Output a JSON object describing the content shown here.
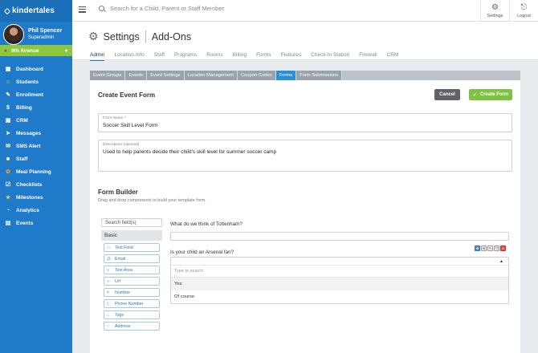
{
  "brand": {
    "name": "kindertales"
  },
  "user": {
    "name": "Phil Spencer",
    "role": "Superadmin"
  },
  "location": {
    "name": "9th Avenue"
  },
  "nav": [
    {
      "label": "Dashboard",
      "icon": "dashboard-icon"
    },
    {
      "label": "Students",
      "icon": "students-icon"
    },
    {
      "label": "Enrollment",
      "icon": "enrollment-icon"
    },
    {
      "label": "Billing",
      "icon": "billing-icon"
    },
    {
      "label": "CRM",
      "icon": "crm-icon"
    },
    {
      "label": "Messages",
      "icon": "messages-icon"
    },
    {
      "label": "SMS Alert",
      "icon": "sms-icon"
    },
    {
      "label": "Staff",
      "icon": "staff-icon"
    },
    {
      "label": "Meal Planning",
      "icon": "meal-icon"
    },
    {
      "label": "Checklists",
      "icon": "checklist-icon"
    },
    {
      "label": "Milestones",
      "icon": "star-icon"
    },
    {
      "label": "Analytics",
      "icon": "analytics-icon"
    },
    {
      "label": "Events",
      "icon": "calendar-icon"
    }
  ],
  "topbar": {
    "search_placeholder": "Search for a Child, Parent or Staff Member",
    "settings_label": "Settings",
    "logout_label": "Logout"
  },
  "header": {
    "title": "Settings",
    "subtitle": "Add-Ons",
    "tabs": [
      "Admin",
      "Location Info",
      "Staff",
      "Programs",
      "Rooms",
      "Billing",
      "Forms",
      "Features",
      "Check-In Station",
      "Firewall",
      "CRM"
    ],
    "active_tab": "Admin"
  },
  "form_tabs": [
    "Event Groups",
    "Events",
    "Event Settings",
    "Location Management",
    "Coupon Codes",
    "Forms",
    "Form Submissions"
  ],
  "active_form_tab": "Forms",
  "form": {
    "title": "Create Event Form",
    "cancel_label": "Cancel",
    "create_label": "Create Form",
    "name_label": "Form Name *",
    "name_value": "Soccer Skill Level Form",
    "desc_label": "Description (optional)",
    "desc_value": "Used to help parents decide their child's skill level for summer soccer camp"
  },
  "builder": {
    "title": "Form Builder",
    "subtitle": "Drag and drop components to build your template form.",
    "palette_search": "Search field(s)",
    "category": "Basic",
    "components": [
      {
        "label": "Text Field",
        "icon": "text-field-icon",
        "glyph": "▭"
      },
      {
        "label": "Email",
        "icon": "at-icon",
        "glyph": "@"
      },
      {
        "label": "Text Area",
        "icon": "text-area-icon",
        "glyph": "≡"
      },
      {
        "label": "Url",
        "icon": "link-icon",
        "glyph": "∞"
      },
      {
        "label": "Number",
        "icon": "hash-icon",
        "glyph": "#"
      },
      {
        "label": "Phone Number",
        "icon": "phone-icon",
        "glyph": "▯"
      },
      {
        "label": "Tags",
        "icon": "tag-icon",
        "glyph": "⌂"
      },
      {
        "label": "Address",
        "icon": "address-icon",
        "glyph": "○"
      }
    ],
    "question1": "What do we think of Tottenham?",
    "question2": "Is your child an Arsenal fan?",
    "dropdown_search": "Type to search",
    "options": [
      "Yes",
      "Of course"
    ]
  }
}
